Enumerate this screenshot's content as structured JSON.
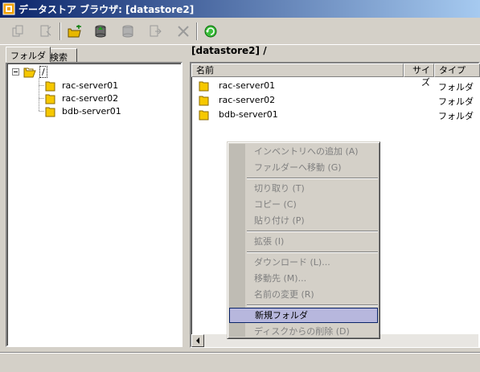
{
  "window": {
    "title": "データストア ブラウザ: [datastore2]"
  },
  "toolbar": {
    "buttons": [
      {
        "icon": "copy-icon",
        "enabled": false
      },
      {
        "icon": "search-datastore-icon",
        "enabled": false
      },
      {
        "icon": "new-folder-icon",
        "enabled": true
      },
      {
        "icon": "upload-icon",
        "enabled": true
      },
      {
        "icon": "download-icon",
        "enabled": false
      },
      {
        "icon": "register-vm-icon",
        "enabled": false
      },
      {
        "icon": "delete-icon",
        "enabled": false
      },
      {
        "icon": "refresh-icon",
        "enabled": true
      }
    ]
  },
  "left": {
    "tabs": [
      "フォルダ",
      "検索"
    ],
    "tree": {
      "root": "/",
      "children": [
        "rac-server01",
        "rac-server02",
        "bdb-server01"
      ]
    }
  },
  "right": {
    "path": "[datastore2] /",
    "columns": [
      "名前",
      "サイズ",
      "タイプ"
    ],
    "rows": [
      {
        "name": "rac-server01",
        "type": "フォルダ"
      },
      {
        "name": "rac-server02",
        "type": "フォルダ"
      },
      {
        "name": "bdb-server01",
        "type": "フォルダ"
      }
    ]
  },
  "context_menu": {
    "items": [
      {
        "label": "インベントリへの追加 (A)",
        "enabled": false
      },
      {
        "label": "ファルダーへ移動 (G)",
        "enabled": false
      },
      {
        "label": "切り取り (T)",
        "enabled": false
      },
      {
        "label": "コピー (C)",
        "enabled": false
      },
      {
        "label": "貼り付け (P)",
        "enabled": false
      },
      {
        "label": "拡張 (I)",
        "enabled": false
      },
      {
        "label": "ダウンロード (L)...",
        "enabled": false
      },
      {
        "label": "移動先 (M)...",
        "enabled": false
      },
      {
        "label": "名前の変更 (R)",
        "enabled": false
      },
      {
        "label": "新規フォルダ",
        "enabled": true,
        "selected": true
      },
      {
        "label": "ディスクからの削除 (D)",
        "enabled": false
      }
    ]
  },
  "colors": {
    "title_start": "#0a246a",
    "title_end": "#a6caf0",
    "menu_highlight": "#b7b7dd"
  }
}
